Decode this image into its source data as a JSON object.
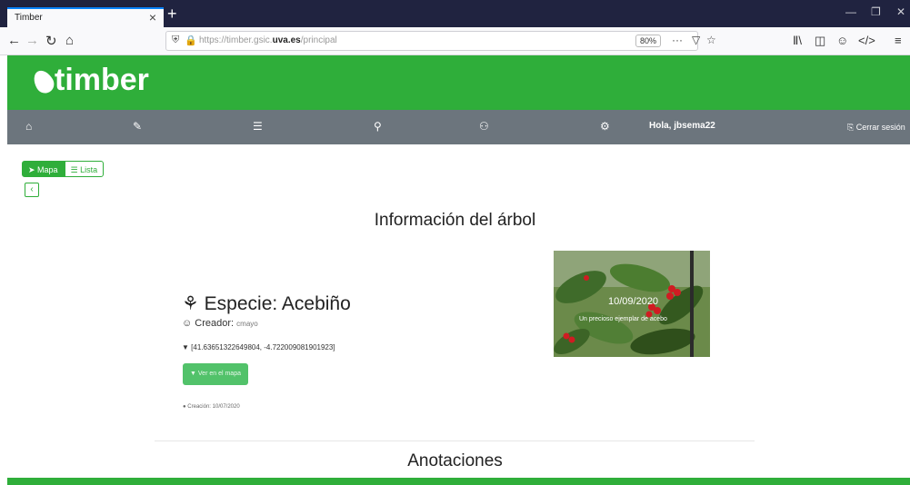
{
  "browser": {
    "tab_title": "Timber",
    "tab_close": "×",
    "new_tab": "+",
    "url_prefix": "https://timber.gsic.",
    "url_domain": "uva.es",
    "url_path": "/principal",
    "zoom": "80%",
    "more": "···",
    "win_min": "—",
    "win_max": "❐",
    "win_close": "✕"
  },
  "site": {
    "logo_text": "timber",
    "brand_color": "#2fae3a",
    "nav_color": "#6c757d"
  },
  "navbar": {
    "items": [
      "home-icon",
      "edit-icon",
      "list-icon",
      "search-icon",
      "users-icon",
      "settings-icon"
    ],
    "greeting": "Hola, jbsema22",
    "logout": "Cerrar sesión"
  },
  "view_toggle": {
    "map_label": "Mapa",
    "list_label": "Lista",
    "back": "‹"
  },
  "tree": {
    "section_title": "Información del árbol",
    "species_label": "Especie: Acebiño",
    "creator_label": "Creador:",
    "creator_value": "cmayo",
    "coordinates": "[41.63651322649804, -4.722009081901923]",
    "map_button": "Ver en el mapa",
    "date_label": "Creación: 10/07/2020",
    "photo_date": "10/09/2020",
    "photo_caption": "Un precioso ejemplar de acebo"
  },
  "annotations": {
    "title": "Anotaciones"
  }
}
